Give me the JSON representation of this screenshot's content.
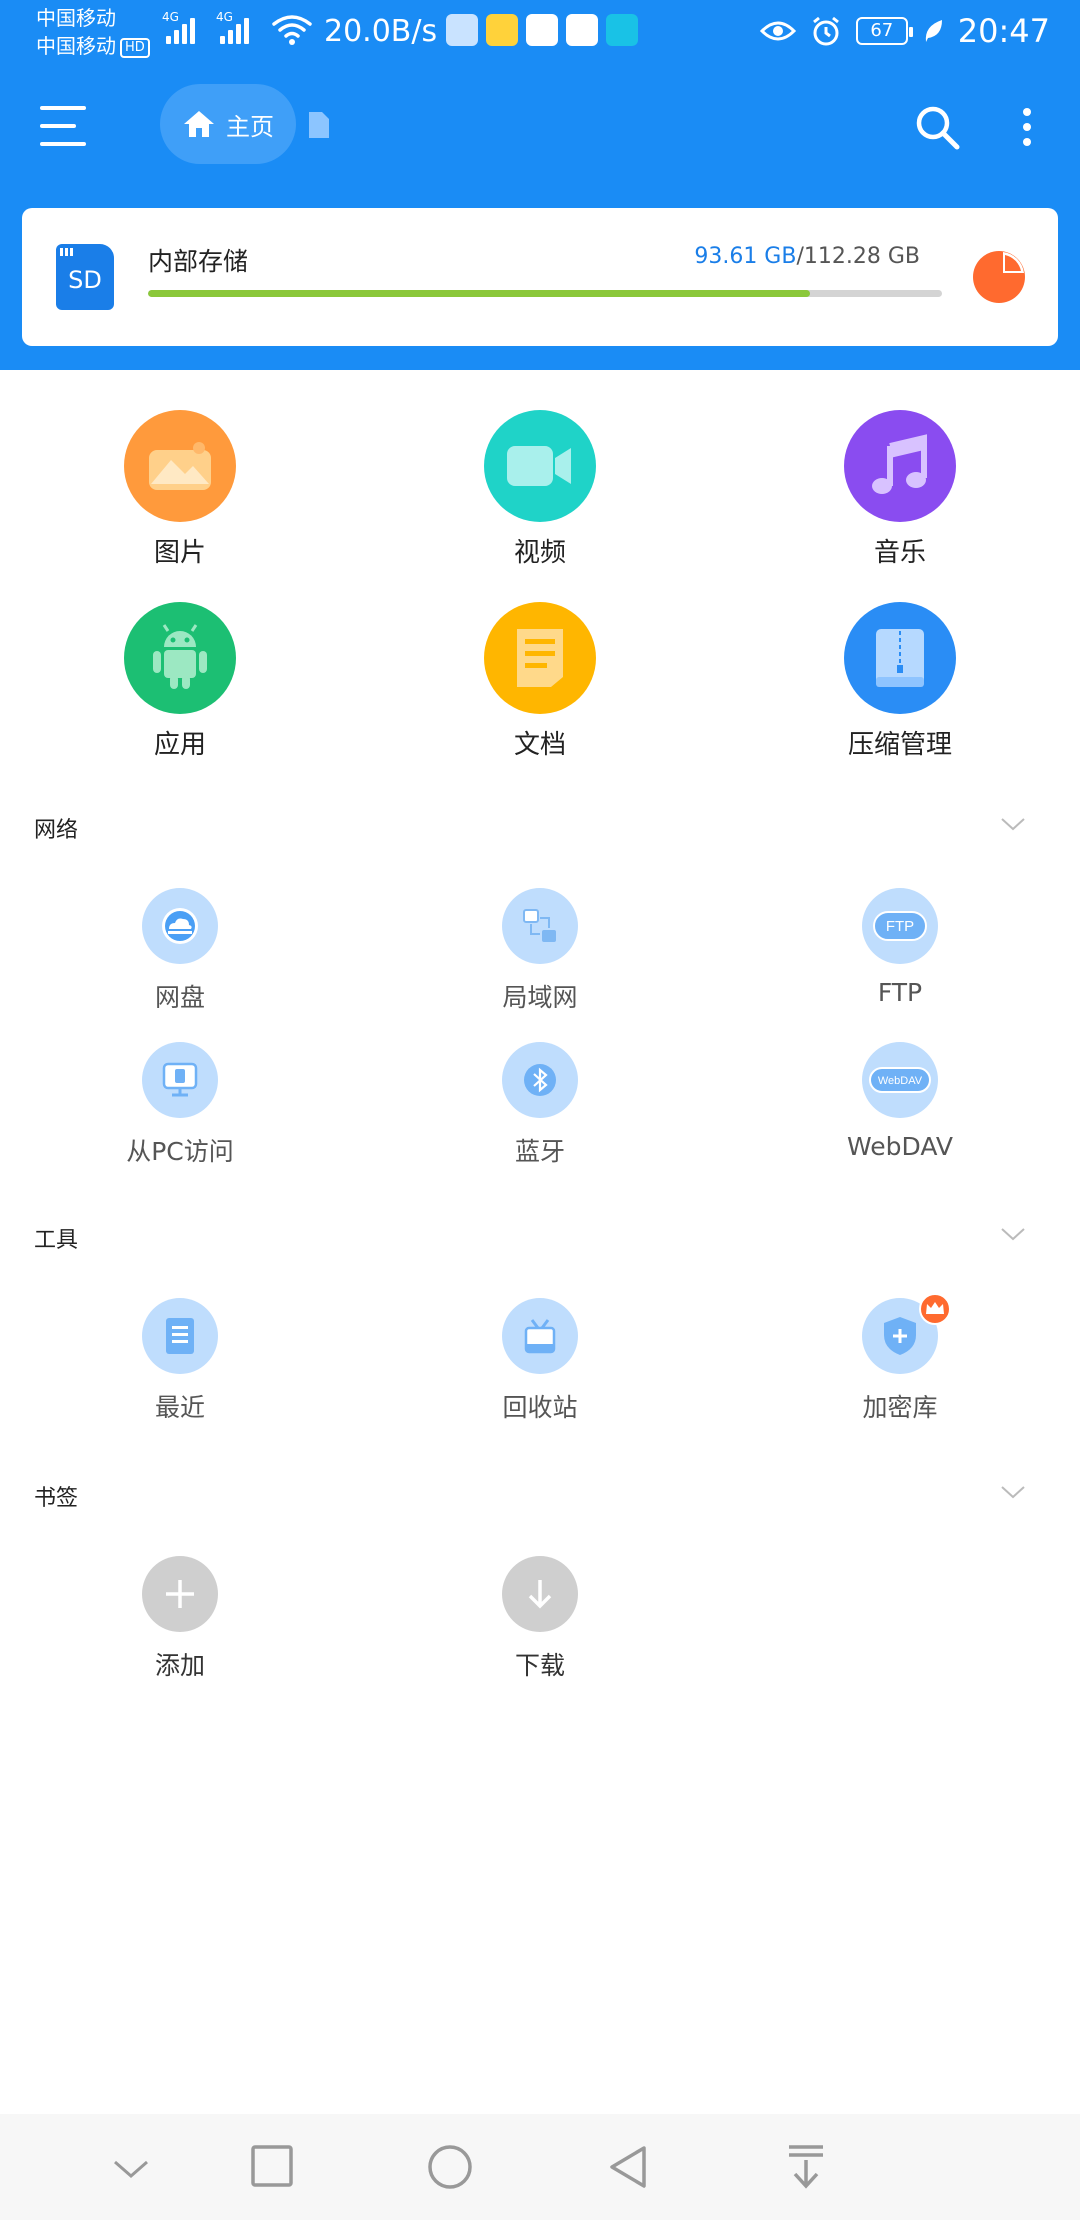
{
  "status_bar": {
    "carrier1": "中国移动",
    "carrier2": "中国移动",
    "hd_badge": "HD",
    "signal1_type": "4G",
    "signal2_type": "4G",
    "net_speed": "20.0B/s",
    "app_icons": [
      "huawei-store-icon",
      "weibo-icon",
      "chat-app-icon",
      "browser-app-icon",
      "taptap-icon"
    ],
    "battery_level": "67",
    "time": "20:47"
  },
  "app_bar": {
    "home_label": "主页",
    "accent_color": "#1a8cf5"
  },
  "storage": {
    "name": "内部存储",
    "sd_label": "SD",
    "used": "93.61 GB",
    "total": "112.28 GB",
    "used_fraction": 0.834
  },
  "categories": [
    {
      "label": "图片",
      "icon": "image-icon",
      "color": "#ff9a3c"
    },
    {
      "label": "视频",
      "icon": "video-icon",
      "color": "#1fd3c8"
    },
    {
      "label": "音乐",
      "icon": "music-icon",
      "color": "#8a4cf0"
    },
    {
      "label": "应用",
      "icon": "android-icon",
      "color": "#1cbf73"
    },
    {
      "label": "文档",
      "icon": "document-icon",
      "color": "#ffb600"
    },
    {
      "label": "压缩管理",
      "icon": "archive-icon",
      "color": "#2a8df5"
    }
  ],
  "network": {
    "title": "网络",
    "items": [
      {
        "label": "网盘",
        "icon": "cloud-drive-icon"
      },
      {
        "label": "局域网",
        "icon": "lan-icon"
      },
      {
        "label": "FTP",
        "icon": "ftp-icon"
      },
      {
        "label": "从PC访问",
        "icon": "pc-access-icon"
      },
      {
        "label": "蓝牙",
        "icon": "bluetooth-icon"
      },
      {
        "label": "WebDAV",
        "icon": "webdav-icon"
      }
    ],
    "ftp_badge": "FTP",
    "webdav_badge": "WebDAV"
  },
  "tools": {
    "title": "工具",
    "items": [
      {
        "label": "最近",
        "icon": "recent-icon"
      },
      {
        "label": "回收站",
        "icon": "recycle-bin-icon"
      },
      {
        "label": "加密库",
        "icon": "vault-icon"
      }
    ]
  },
  "bookmarks": {
    "title": "书签",
    "items": [
      {
        "label": "添加",
        "icon": "plus-icon"
      },
      {
        "label": "下载",
        "icon": "download-icon"
      }
    ]
  }
}
